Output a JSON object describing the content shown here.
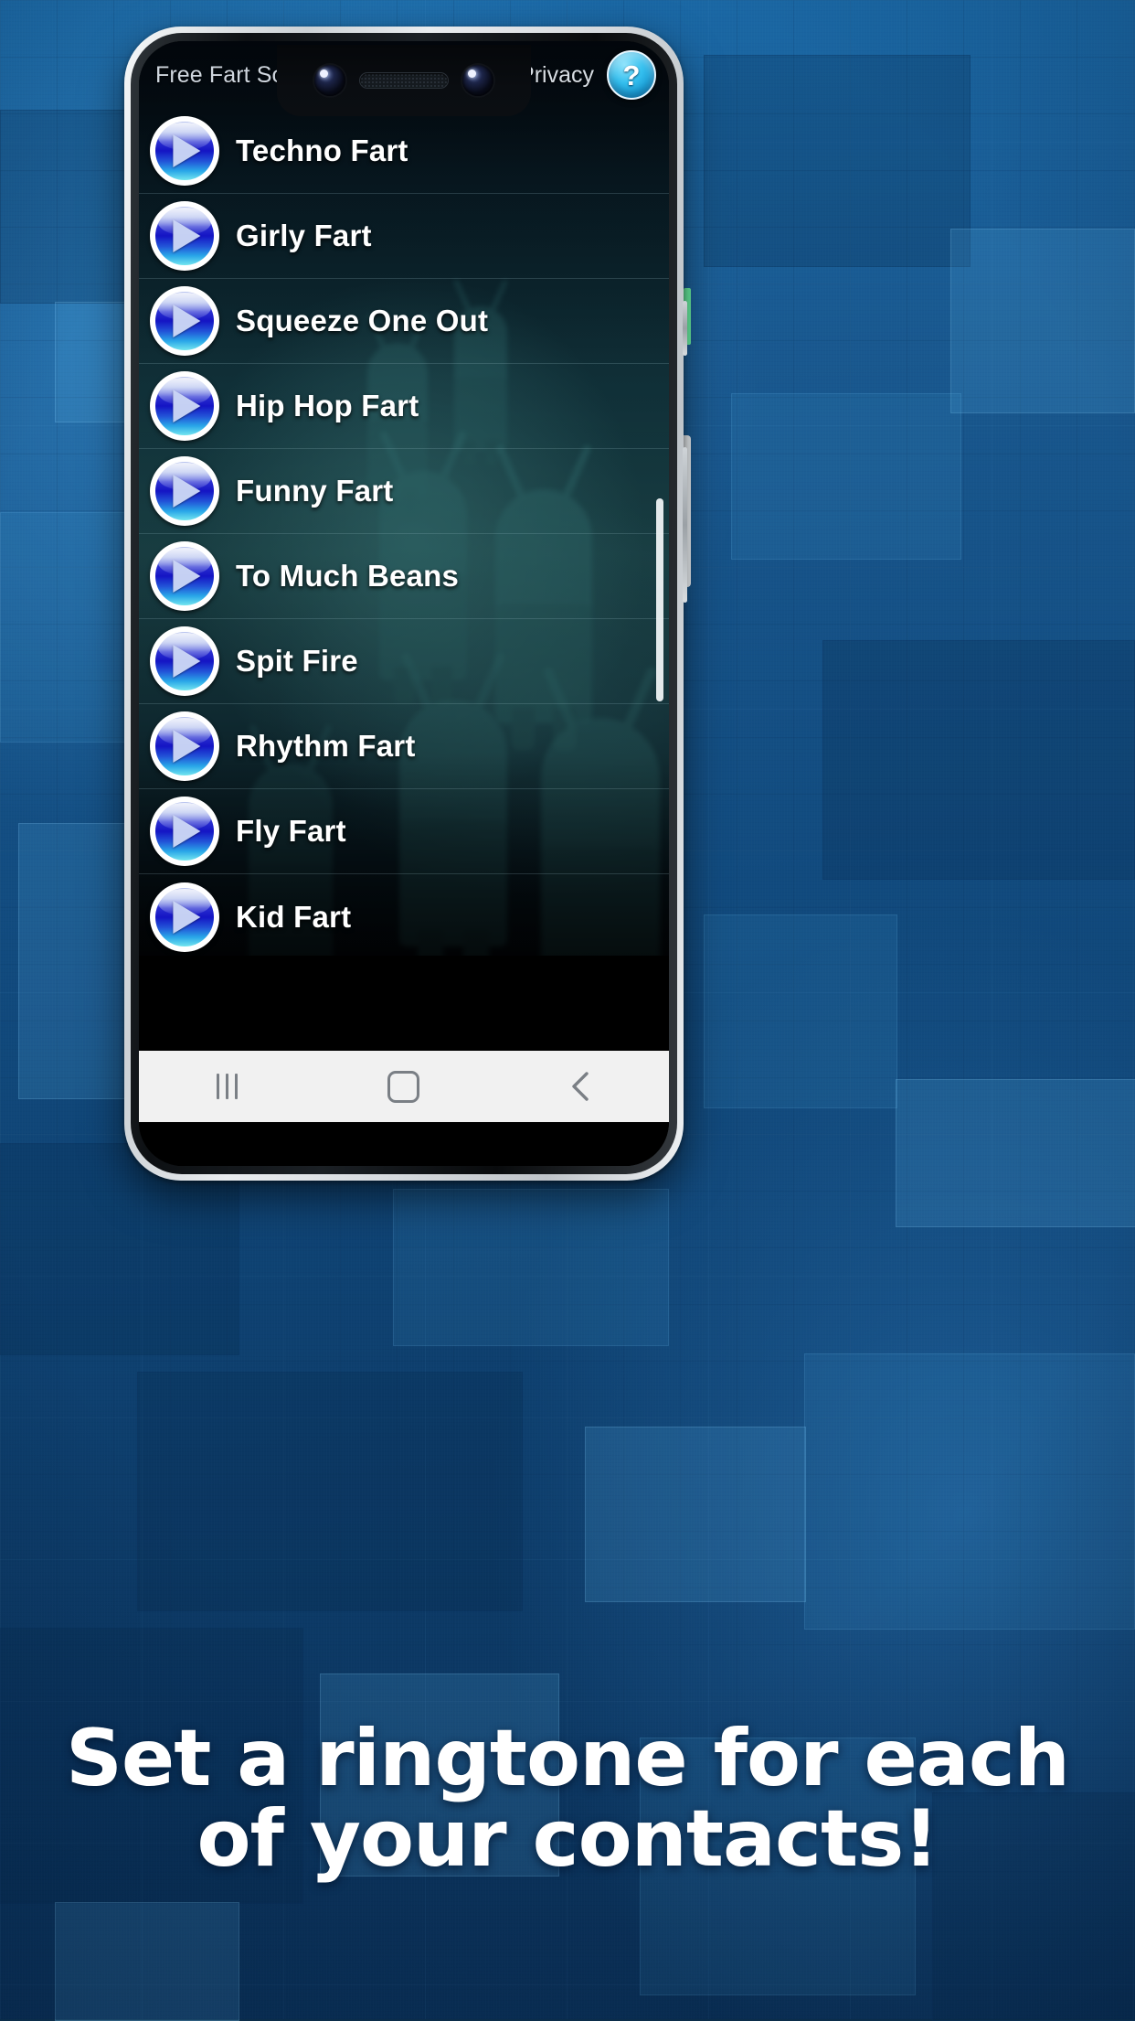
{
  "app": {
    "title": "Free Fart Sounds",
    "privacy_label": "Privacy",
    "help_icon_label": "?"
  },
  "sounds": [
    {
      "name": "Techno Fart",
      "play_icon": "play-icon"
    },
    {
      "name": "Girly Fart",
      "play_icon": "play-icon"
    },
    {
      "name": "Squeeze One Out",
      "play_icon": "play-icon"
    },
    {
      "name": "Hip Hop Fart",
      "play_icon": "play-icon"
    },
    {
      "name": "Funny Fart",
      "play_icon": "play-icon"
    },
    {
      "name": "To Much Beans",
      "play_icon": "play-icon"
    },
    {
      "name": "Spit Fire",
      "play_icon": "play-icon"
    },
    {
      "name": "Rhythm Fart",
      "play_icon": "play-icon"
    },
    {
      "name": "Fly Fart",
      "play_icon": "play-icon"
    },
    {
      "name": "Kid Fart",
      "play_icon": "play-icon"
    }
  ],
  "navbar": {
    "recents_icon": "recents-icon",
    "home_icon": "home-icon",
    "back_icon": "back-icon"
  },
  "promo": {
    "line1": "Set a ringtone for each",
    "line2": "of your contacts!"
  },
  "colors": {
    "background_blue": "#114a7e",
    "accent_green": "#6af2a3",
    "accent_white": "#eef2f5",
    "help_blue": "#35c0ef",
    "play_blue": "#1414c4",
    "text_white": "#ffffff",
    "navbar_gray": "#f1f1f1"
  }
}
